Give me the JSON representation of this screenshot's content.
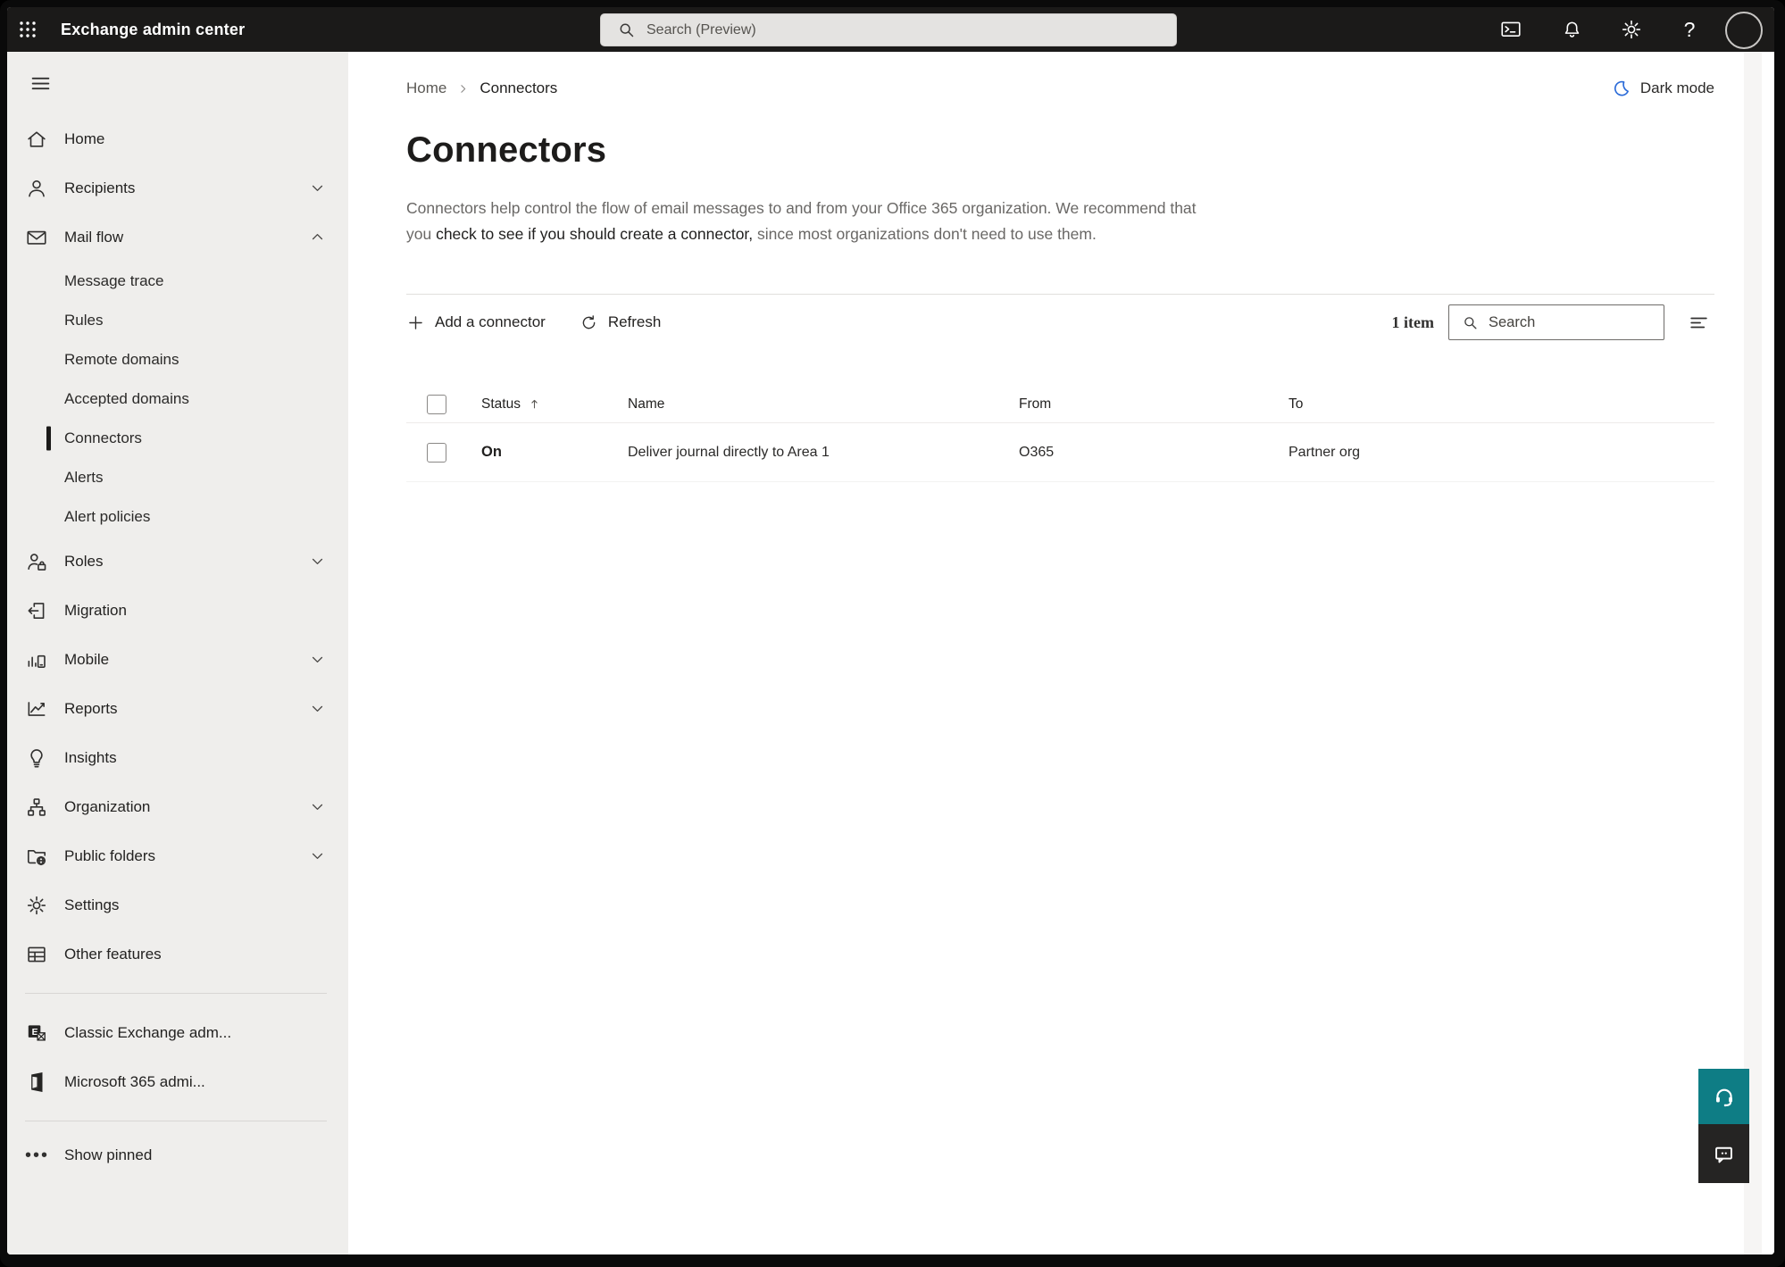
{
  "topbar": {
    "app_title": "Exchange admin center",
    "search_placeholder": "Search (Preview)"
  },
  "sidebar": {
    "items": {
      "home": "Home",
      "recipients": "Recipients",
      "mail_flow": "Mail flow",
      "message_trace": "Message trace",
      "rules": "Rules",
      "remote_domains": "Remote domains",
      "accepted_domains": "Accepted domains",
      "connectors": "Connectors",
      "alerts": "Alerts",
      "alert_policies": "Alert policies",
      "roles": "Roles",
      "migration": "Migration",
      "mobile": "Mobile",
      "reports": "Reports",
      "insights": "Insights",
      "organization": "Organization",
      "public_folders": "Public folders",
      "settings": "Settings",
      "other_features": "Other features",
      "classic_exchange": "Classic Exchange adm...",
      "m365_admin": "Microsoft 365 admi...",
      "show_pinned": "Show pinned"
    }
  },
  "main": {
    "breadcrumb": {
      "home": "Home",
      "current": "Connectors"
    },
    "dark_mode_label": "Dark mode",
    "title": "Connectors",
    "description": {
      "part1": "Connectors help control the flow of email messages to and from your Office 365 organization. We recommend that you ",
      "emphasis": "check to see if you should create a connector,",
      "part2": " since most organizations don't need to use them."
    },
    "toolbar": {
      "add_label": "Add a connector",
      "refresh_label": "Refresh",
      "item_count": "1 item",
      "search_placeholder": "Search"
    },
    "table": {
      "columns": {
        "status": "Status",
        "name": "Name",
        "from": "From",
        "to": "To"
      },
      "rows": [
        {
          "status": "On",
          "name": "Deliver journal directly to Area 1",
          "from": "O365",
          "to": "Partner org"
        }
      ]
    }
  },
  "colors": {
    "topbar_bg": "#1b1a19",
    "sidebar_bg": "#efeeec",
    "moon_blue": "#2b6bd8",
    "help_teal": "#0e7d85",
    "feedback_dark": "#252423"
  }
}
